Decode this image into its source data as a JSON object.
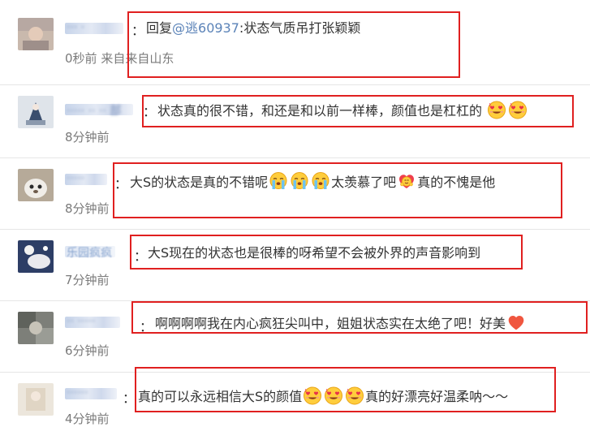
{
  "comments": [
    {
      "user": "··· ·",
      "reply_prefix": "回复",
      "mention": "@逃60937",
      "text": ":状态气质吊打张颖颖",
      "time": "0秒前",
      "source": "来自来自山东"
    },
    {
      "user": "····· ··  ·· 部",
      "text": "状态真的很不错，和还是和以前一样棒，颜值也是杠杠的",
      "emojis": [
        "heart-eyes-emoji",
        "heart-eyes-emoji"
      ],
      "time": "8分钟前"
    },
    {
      "user": "·····",
      "text_a": "大S的状态是真的不错呢",
      "emojis_a": [
        "crying-emoji",
        "crying-emoji",
        "crying-emoji"
      ],
      "text_b": "太羡慕了吧",
      "emojis_b": [
        "heart-hug-emoji"
      ],
      "text_c": "真的不愧是他",
      "time": "8分钟前"
    },
    {
      "user": "乐园疯疯",
      "text": "大S现在的状态也是很棒的呀希望不会被外界的声音影响到",
      "time": "7分钟前"
    },
    {
      "user": "··  ·····",
      "text": "啊啊啊啊我在内心疯狂尖叫中，姐姐状态实在太绝了吧！好美",
      "emojis": [
        "red-heart-emoji"
      ],
      "time": "6分钟前"
    },
    {
      "user": "······",
      "text_a": "真的可以永远相信大S的颜值",
      "emojis_a": [
        "heart-eyes-emoji",
        "heart-eyes-emoji",
        "heart-eyes-emoji"
      ],
      "text_b": "真的好漂亮好温柔呐～～",
      "time": "4分钟前"
    }
  ],
  "colon": "：",
  "colors": {
    "highlight_box": "#e02020",
    "mention": "#5b83b8",
    "timestamp": "#7a7a7a"
  }
}
